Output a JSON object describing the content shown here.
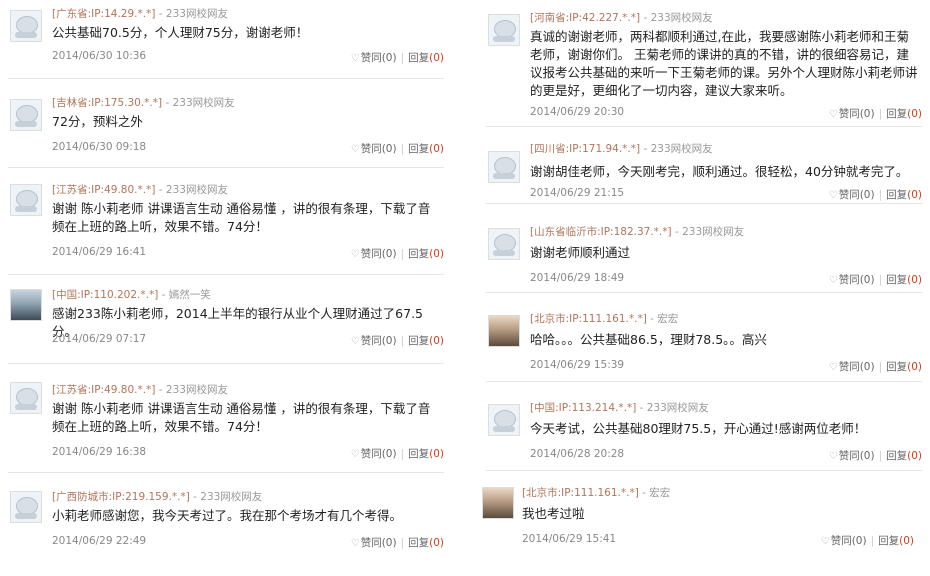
{
  "left": [
    {
      "ip": "[广东省:IP:14.29.*.*]",
      "sep": " - ",
      "user": "233网校网友",
      "text": "公共基础70.5分，个人理财75分，谢谢老师！",
      "date": "2014/06/30 10:36",
      "like_label": "赞同",
      "like_count": "(0)",
      "reply_label": "回复",
      "reply_count": "(0)"
    },
    {
      "ip": "[吉林省:IP:175.30.*.*]",
      "sep": " - ",
      "user": "233网校网友",
      "text": "72分，预料之外",
      "date": "2014/06/30 09:18",
      "like_label": "赞同",
      "like_count": "(0)",
      "reply_label": "回复",
      "reply_count": "(0)"
    },
    {
      "ip": "[江苏省:IP:49.80.*.*]",
      "sep": " - ",
      "user": "233网校网友",
      "text": "谢谢 陈小莉老师 讲课语言生动 通俗易懂 ，讲的很有条理，下载了音频在上班的路上听，效果不错。74分！",
      "date": "2014/06/29 16:41",
      "like_label": "赞同",
      "like_count": "(0)",
      "reply_label": "回复",
      "reply_count": "(0)"
    },
    {
      "ip": "[中国:IP:110.202.*.*]",
      "sep": " - ",
      "user": "嫣然一笑",
      "text": "感谢233陈小莉老师，2014上半年的银行从业个人理财通过了67.5分。",
      "date": "2014/06/29 07:17",
      "like_label": "赞同",
      "like_count": "(0)",
      "reply_label": "回复",
      "reply_count": "(0)"
    },
    {
      "ip": "[江苏省:IP:49.80.*.*]",
      "sep": " - ",
      "user": "233网校网友",
      "text": "谢谢 陈小莉老师 讲课语言生动 通俗易懂 ，讲的很有条理，下载了音频在上班的路上听，效果不错。74分！",
      "date": "2014/06/29 16:38",
      "like_label": "赞同",
      "like_count": "(0)",
      "reply_label": "回复",
      "reply_count": "(0)"
    },
    {
      "ip": "[广西防城市:IP:219.159.*.*]",
      "sep": " - ",
      "user": "233网校网友",
      "text": "小莉老师感谢您，我今天考过了。我在那个考场才有几个考得。",
      "date": "2014/06/29 22:49",
      "like_label": "赞同",
      "like_count": "(0)",
      "reply_label": "回复",
      "reply_count": "(0)"
    }
  ],
  "right": [
    {
      "ip": "[河南省:IP:42.227.*.*]",
      "sep": " - ",
      "user": "233网校网友",
      "text": "真诚的谢谢老师，两科都顺利通过,在此，我要感谢陈小莉老师和王菊老师，谢谢你们。 王菊老师的课讲的真的不错，讲的很细容易记，建议报考公共基础的来听一下王菊老师的课。另外个人理财陈小莉老师讲的更是好，更细化了一切内容，建议大家来听。",
      "date": "2014/06/29 20:30",
      "like_label": "赞同",
      "like_count": "(0)",
      "reply_label": "回复",
      "reply_count": "(0)"
    },
    {
      "ip": "[四川省:IP:171.94.*.*]",
      "sep": " - ",
      "user": "233网校网友",
      "text": "谢谢胡佳老师，今天刚考完，顺利通过。很轻松，40分钟就考完了。",
      "date": "2014/06/29 21:15",
      "like_label": "赞同",
      "like_count": "(0)",
      "reply_label": "回复",
      "reply_count": "(0)"
    },
    {
      "ip": "[山东省临沂市:IP:182.37.*.*]",
      "sep": " - ",
      "user": "233网校网友",
      "text": "谢谢老师顺利通过",
      "date": "2014/06/29 18:49",
      "like_label": "赞同",
      "like_count": "(0)",
      "reply_label": "回复",
      "reply_count": "(0)"
    },
    {
      "ip": "[北京市:IP:111.161.*.*]",
      "sep": " - ",
      "user": "宏宏",
      "text": "哈哈。。。公共基础86.5，理财78.5。。高兴",
      "date": "2014/06/29 15:39",
      "like_label": "赞同",
      "like_count": "(0)",
      "reply_label": "回复",
      "reply_count": "(0)"
    },
    {
      "ip": "[中国:IP:113.214.*.*]",
      "sep": " - ",
      "user": "233网校网友",
      "text": "今天考试，公共基础80理财75.5，开心通过!感谢两位老师！",
      "date": "2014/06/28 20:28",
      "like_label": "赞同",
      "like_count": "(0)",
      "reply_label": "回复",
      "reply_count": "(0)"
    },
    {
      "ip": "[北京市:IP:111.161.*.*]",
      "sep": " - ",
      "user": "宏宏",
      "text": "我也考过啦",
      "date": "2014/06/29 15:41",
      "like_label": "赞同",
      "like_count": "(0)",
      "reply_label": "回复",
      "reply_count": "(0)"
    }
  ]
}
